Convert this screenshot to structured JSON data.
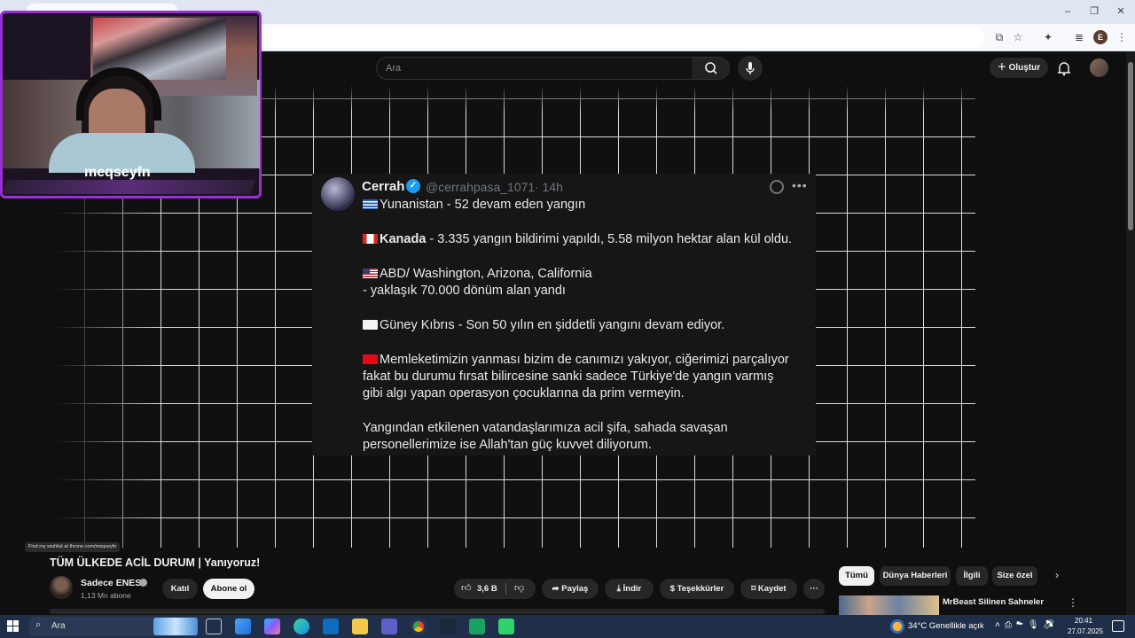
{
  "browser": {
    "window_controls": [
      "–",
      "❐",
      "✕"
    ]
  },
  "masthead": {
    "search_placeholder": "Ara",
    "create_label": "Oluştur"
  },
  "tweet": {
    "author_name": "Cerrah",
    "handle": "@cerrahpasa_1071",
    "time": "· 14h",
    "lines": [
      {
        "flag": "greece",
        "bold": "",
        "text": "Yunanistan - 52 devam eden yangın"
      },
      {
        "flag": "canada",
        "bold": "Kanada",
        "text": " - 3.335 yangın bildirimi yapıldı, 5.58 milyon hektar alan kül oldu."
      },
      {
        "flag": "usa",
        "bold": "",
        "text": "ABD/ Washington, Arizona, California"
      },
      {
        "flag": "",
        "bold": "",
        "text": "- yaklaşık 70.000 dönüm alan yandı"
      },
      {
        "flag": "cyprus",
        "bold": "",
        "text": "Güney Kıbrıs - Son 50 yılın en şiddetli yangını devam ediyor."
      },
      {
        "flag": "turkey",
        "bold": "",
        "text": "Memleketimizin yanması bizim de canımızı yakıyor, ciğerimizi parçalıyor"
      },
      {
        "flag": "",
        "bold": "",
        "text": "fakat bu durumu fırsat bilircesine sanki sadece Türkiye'de yangın varmış"
      },
      {
        "flag": "",
        "bold": "",
        "text": "gibi algı yapan operasyon çocuklarına da prim vermeyin."
      },
      {
        "flag": "",
        "bold": "",
        "text": "Yangından etkilenen vatandaşlarımıza acil şifa, sahada savaşan"
      },
      {
        "flag": "",
        "bold": "",
        "text": "personellerimize ise Allah'tan güç kuvvet diliyorum."
      }
    ]
  },
  "webcam": {
    "label": "meqseyfn"
  },
  "video": {
    "wishlist_chip": "Find my wishlist at throne.com/meqseyfn",
    "title": "TÜM ÜLKEDE ACİL DURUM | Yanıyoruz!",
    "channel_name": "Sadece ENES",
    "subscribers": "1,13 Mn abone",
    "join_label": "Katıl",
    "subscribe_label": "Abone ol",
    "likes": "3,6 B",
    "share_label": "Paylaş",
    "download_label": "İndir",
    "thanks_label": "Teşekkürler",
    "save_label": "Kaydet"
  },
  "chips": [
    "Tümü",
    "Dünya Haberleri",
    "İlgili",
    "Size özel"
  ],
  "recommendation": {
    "title": "MrBeast Silinen Sahneler"
  },
  "taskbar": {
    "search_placeholder": "Ara",
    "weather": "34°C  Genellikle açık",
    "time": "20:41",
    "date": "27.07.2025"
  },
  "colors": {
    "youtube_bg": "#0f0f0f",
    "tweet_bg": "#161616",
    "verified_blue": "#1d9bf0",
    "cam_border": "#9b2fd6",
    "taskbar_bg": "#1f2f4a"
  }
}
